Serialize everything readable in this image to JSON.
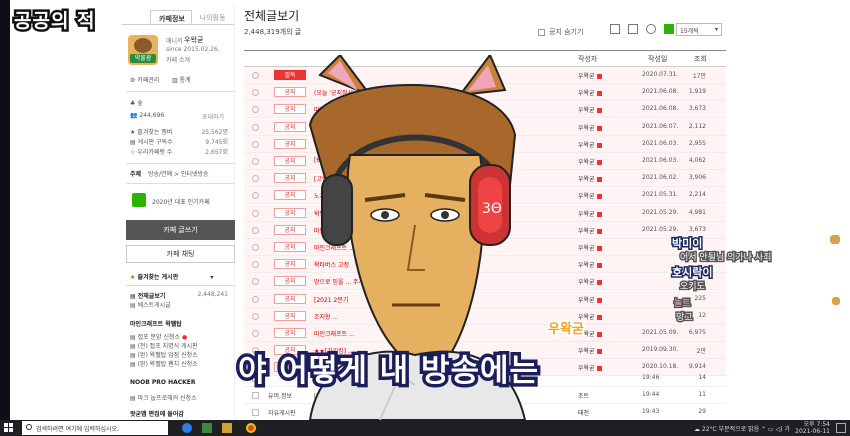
{
  "stream_title": "공공의 적",
  "sidebar": {
    "tab_active": "카페정보",
    "tab_other": "나의활동",
    "badge_text": "약물광",
    "manager_label": "매니저",
    "manager_name": "우왁굳",
    "since": "since 2015.02.26.",
    "cafe_intro": "카페 소개",
    "cafe_manage": "카페관리",
    "stats": "통계",
    "level": "숲",
    "members": "244,696",
    "invite": "초대하기",
    "fav_member_label": "즐겨찾는 멤버",
    "fav_member_value": "25,562명",
    "board_sub_label": "게시판 구독수",
    "board_sub_value": "9,745회",
    "ranking_label": "우리카페랭 수",
    "ranking_value": "2,657회",
    "topics_label": "주제",
    "topics": "방송/연예 > 인터넷방송",
    "award": "2020년 대표 인기카페",
    "write_btn": "카페 글쓰기",
    "chat_btn": "카페 채팅",
    "fav_boards_header": "즐겨찾는 게시판",
    "all_posts": "전체글보기",
    "all_posts_count": "2,448,241",
    "best_posts": "베스트게시글",
    "section_minecraft": "마인크래프트 왁펠탑",
    "mc_items": [
      "접포 분양 신청소",
      "(전) 접포 지명식 게시판",
      "(완) 왁펠탑 입점 신청소",
      "(완) 왁펠탑 팬치 신청소"
    ],
    "section_noob": "NOOB PRO HACKER",
    "noob_items": [
      "마크 눕프로해커 신청소"
    ],
    "section_ubp": "왓굳맵 편집에 들어감"
  },
  "main": {
    "title": "전체글보기",
    "count": "2,448,319개의 글",
    "notice_toggle": "공지 숨기기",
    "per_page": "15개씩",
    "col_author": "작성자",
    "col_date": "작성일",
    "col_views": "조회",
    "rows": [
      {
        "tag": "필독",
        "must": true,
        "title": "",
        "author": "우왁굳",
        "date": "2020.07.31.",
        "views": "17만"
      },
      {
        "tag": "공지",
        "title": "(오늘 '공지정서' 를 제출해주세요",
        "author": "우왁굳",
        "date": "2021.06.08.",
        "views": "1,919"
      },
      {
        "tag": "공지",
        "title": "마인",
        "author": "우왁굳",
        "date": "2021.06.08.",
        "views": "3,673"
      },
      {
        "tag": "공지",
        "title": "오늘",
        "author": "우왁굳",
        "date": "2021.06.07.",
        "views": "2,112"
      },
      {
        "tag": "공지",
        "title": "접포 ... [31]",
        "author": "우왁굳",
        "date": "2021.06.03.",
        "views": "2,955"
      },
      {
        "tag": "공지",
        "title": "[6.8.",
        "author": "우왁굳",
        "date": "2021.06.03.",
        "views": "4,062"
      },
      {
        "tag": "공지",
        "title": "[고랩] ... 습니다.",
        "author": "우왁굳",
        "date": "2021.06.02.",
        "views": "3,906"
      },
      {
        "tag": "공지",
        "title": "노가리",
        "author": "우왁굳",
        "date": "2021.05.31.",
        "views": "2,214"
      },
      {
        "tag": "공지",
        "title": "왁펠탑",
        "author": "우왁굳",
        "date": "2021.05.29.",
        "views": "4,981"
      },
      {
        "tag": "공지",
        "title": "마인크래프트",
        "author": "우왁굳",
        "date": "2021.05.29.",
        "views": "3,673"
      },
      {
        "tag": "공지",
        "title": "마인크래프트 ... 수정) [130]",
        "author": "우왁굳",
        "date": "",
        "views": ""
      },
      {
        "tag": "공지",
        "title": "왁타버스 고정",
        "author": "우왁굳",
        "date": "",
        "views": ""
      },
      {
        "tag": "공지",
        "title": "망으로 믿을 ... 주세요) (왕시수정)",
        "author": "우왁굳",
        "date": "",
        "views": ""
      },
      {
        "tag": "공지",
        "title": "[2021 2분기",
        "author": "우왁굳",
        "date": "",
        "views": "225"
      },
      {
        "tag": "공지",
        "title": "조지왕 ...",
        "author": "우왁굳",
        "date": "",
        "views": "12"
      },
      {
        "tag": "공지",
        "title": "마인크래프트 ...",
        "author": "우왁굳",
        "date": "2021.05.09.",
        "views": "6,975"
      },
      {
        "tag": "공지",
        "title": "★★[가리킹] ...",
        "author": "우왁굳",
        "date": "2019.09.30.",
        "views": "2만"
      },
      {
        "tag": "공지",
        "title": "",
        "author": "우왁굳",
        "date": "2020.10.18.",
        "views": "9,914"
      }
    ],
    "bottom_rows": [
      {
        "board": "",
        "title": "",
        "author": "",
        "time": "19:46",
        "views": "14"
      },
      {
        "board": "유머,정보",
        "title": "[먼급...",
        "author": "조트",
        "time": "19:44",
        "views": "11"
      },
      {
        "board": "자유게시판",
        "title": "[먼급]...",
        "author": "태천",
        "time": "19:43",
        "views": "29"
      }
    ]
  },
  "overlay": {
    "subtitle": "야 어떻게 내 방송에는",
    "speaker": "우왁굳",
    "chat": [
      {
        "name": "박미이",
        "msg": "어서 안될님 의가나 사죄"
      },
      {
        "name": "호시락이",
        "msg": "오키도"
      },
      {
        "name": "",
        "msg": "놀트"
      },
      {
        "name": "",
        "msg": "망고"
      }
    ]
  },
  "taskbar": {
    "search_placeholder": "검색하려면 여기에 입력하십시오.",
    "weather": "22°C 부분적으로 맑음",
    "time": "오후 7:54",
    "date": "2021-06-11"
  }
}
